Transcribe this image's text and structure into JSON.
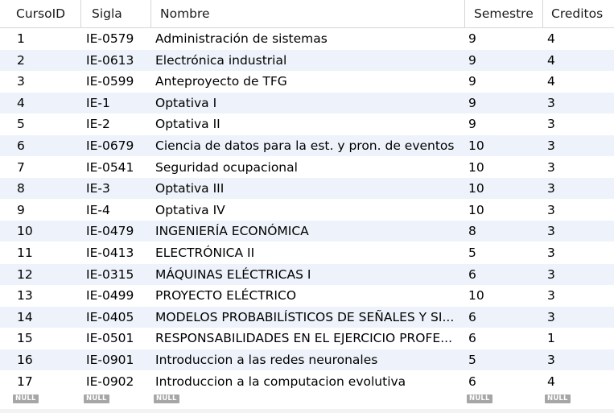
{
  "columns": [
    "CursoID",
    "Sigla",
    "Nombre",
    "Semestre",
    "Creditos"
  ],
  "rows": [
    [
      "1",
      "IE-0579",
      "Administración de sistemas",
      "9",
      "4"
    ],
    [
      "2",
      "IE-0613",
      "Electrónica industrial",
      "9",
      "4"
    ],
    [
      "3",
      "IE-0599",
      "Anteproyecto de TFG",
      "9",
      "4"
    ],
    [
      "4",
      "IE-1",
      "Optativa I",
      "9",
      "3"
    ],
    [
      "5",
      "IE-2",
      "Optativa II",
      "9",
      "3"
    ],
    [
      "6",
      "IE-0679",
      "Ciencia de datos para la est. y pron. de eventos",
      "10",
      "3"
    ],
    [
      "7",
      "IE-0541",
      "Seguridad ocupacional",
      "10",
      "3"
    ],
    [
      "8",
      "IE-3",
      "Optativa III",
      "10",
      "3"
    ],
    [
      "9",
      "IE-4",
      "Optativa IV",
      "10",
      "3"
    ],
    [
      "10",
      "IE-0479",
      "INGENIERÍA ECONÓMICA",
      "8",
      "3"
    ],
    [
      "11",
      "IE-0413",
      "ELECTRÓNICA II",
      "5",
      "3"
    ],
    [
      "12",
      "IE-0315",
      "MÁQUINAS ELÉCTRICAS I",
      "6",
      "3"
    ],
    [
      "13",
      "IE-0499",
      "PROYECTO ELÉCTRICO",
      "10",
      "3"
    ],
    [
      "14",
      "IE-0405",
      "MODELOS PROBABILÍSTICOS DE SEÑALES Y SI...",
      "6",
      "3"
    ],
    [
      "15",
      "IE-0501",
      "RESPONSABILIDADES EN EL EJERCICIO PROFE...",
      "6",
      "1"
    ],
    [
      "16",
      "IE-0901",
      "Introduccion a las redes neuronales",
      "5",
      "3"
    ],
    [
      "17",
      "IE-0902",
      "Introduccion a la computacion evolutiva",
      "6",
      "4"
    ]
  ],
  "null_label": "NULL",
  "colors": {
    "alt_row": "#eef3fb",
    "grid_line": "#d6d6d6",
    "null_badge": "#a6a6a6"
  }
}
